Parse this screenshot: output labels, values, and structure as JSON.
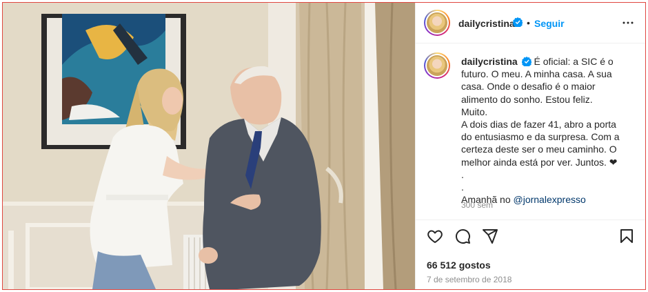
{
  "post": {
    "username": "dailycristina",
    "separator": "•",
    "follow_label": "Seguir",
    "caption_lines": [
      "É oficial: a SIC é o",
      "futuro. O meu. A minha casa. A sua",
      "casa. Onde o desafio é o maior",
      "alimento do sonho. Estou feliz. Muito.",
      "A dois dias de fazer 41, abro a porta",
      "do entusiasmo e da surpresa. Com a",
      "certeza deste ser o meu caminho. O",
      "melhor ainda está por ver. Juntos. ❤",
      ".",
      "."
    ],
    "tomorrow_prefix": "Amanhã no",
    "mention": "@jornalexpresso",
    "time_ago": "300 sem",
    "likes": "66 512 gostos",
    "date": "7 de setembro de 2018"
  },
  "icons": {
    "verified": "verified-badge-icon",
    "more": "more-options-icon",
    "like": "heart-icon",
    "comment": "comment-icon",
    "share": "share-icon",
    "save": "bookmark-icon"
  },
  "colors": {
    "accent": "#0095f6",
    "verified": "#0095f6",
    "mention": "#00376b",
    "secondary_text": "#8e8e8e"
  }
}
